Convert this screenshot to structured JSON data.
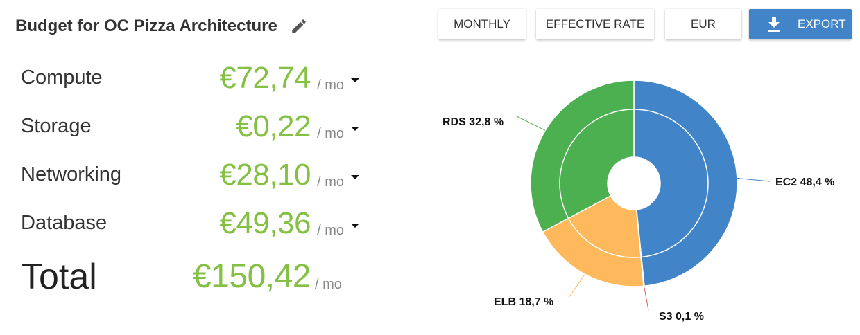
{
  "header": {
    "title": "Budget for OC Pizza Architecture",
    "edit_icon": "pencil-icon"
  },
  "toolbar": {
    "monthly_label": "MONTHLY",
    "effective_rate_label": "EFFECTIVE RATE",
    "currency_label": "EUR",
    "export_label": "EXPORT",
    "export_icon": "download-icon",
    "export_color": "#4185c8"
  },
  "budget": {
    "value_color": "#84c143",
    "rows": [
      {
        "label": "Compute",
        "value": "€72,74",
        "unit": "/ mo"
      },
      {
        "label": "Storage",
        "value": "€0,22",
        "unit": "/ mo"
      },
      {
        "label": "Networking",
        "value": "€28,10",
        "unit": "/ mo"
      },
      {
        "label": "Database",
        "value": "€49,36",
        "unit": "/ mo"
      }
    ],
    "total": {
      "label": "Total",
      "value": "€150,42",
      "unit": "/ mo"
    }
  },
  "chart_data": {
    "type": "pie",
    "donut": true,
    "slices": [
      {
        "name": "EC2",
        "value": 48.4,
        "label": "EC2 48,4 %",
        "color": "#4185c8"
      },
      {
        "name": "S3",
        "value": 0.1,
        "label": "S3 0,1 %",
        "color": "#e05a5a"
      },
      {
        "name": "ELB",
        "value": 18.7,
        "label": "ELB 18,7 %",
        "color": "#fdb95b"
      },
      {
        "name": "RDS",
        "value": 32.8,
        "label": "RDS 32,8 %",
        "color": "#4cb050"
      }
    ]
  }
}
